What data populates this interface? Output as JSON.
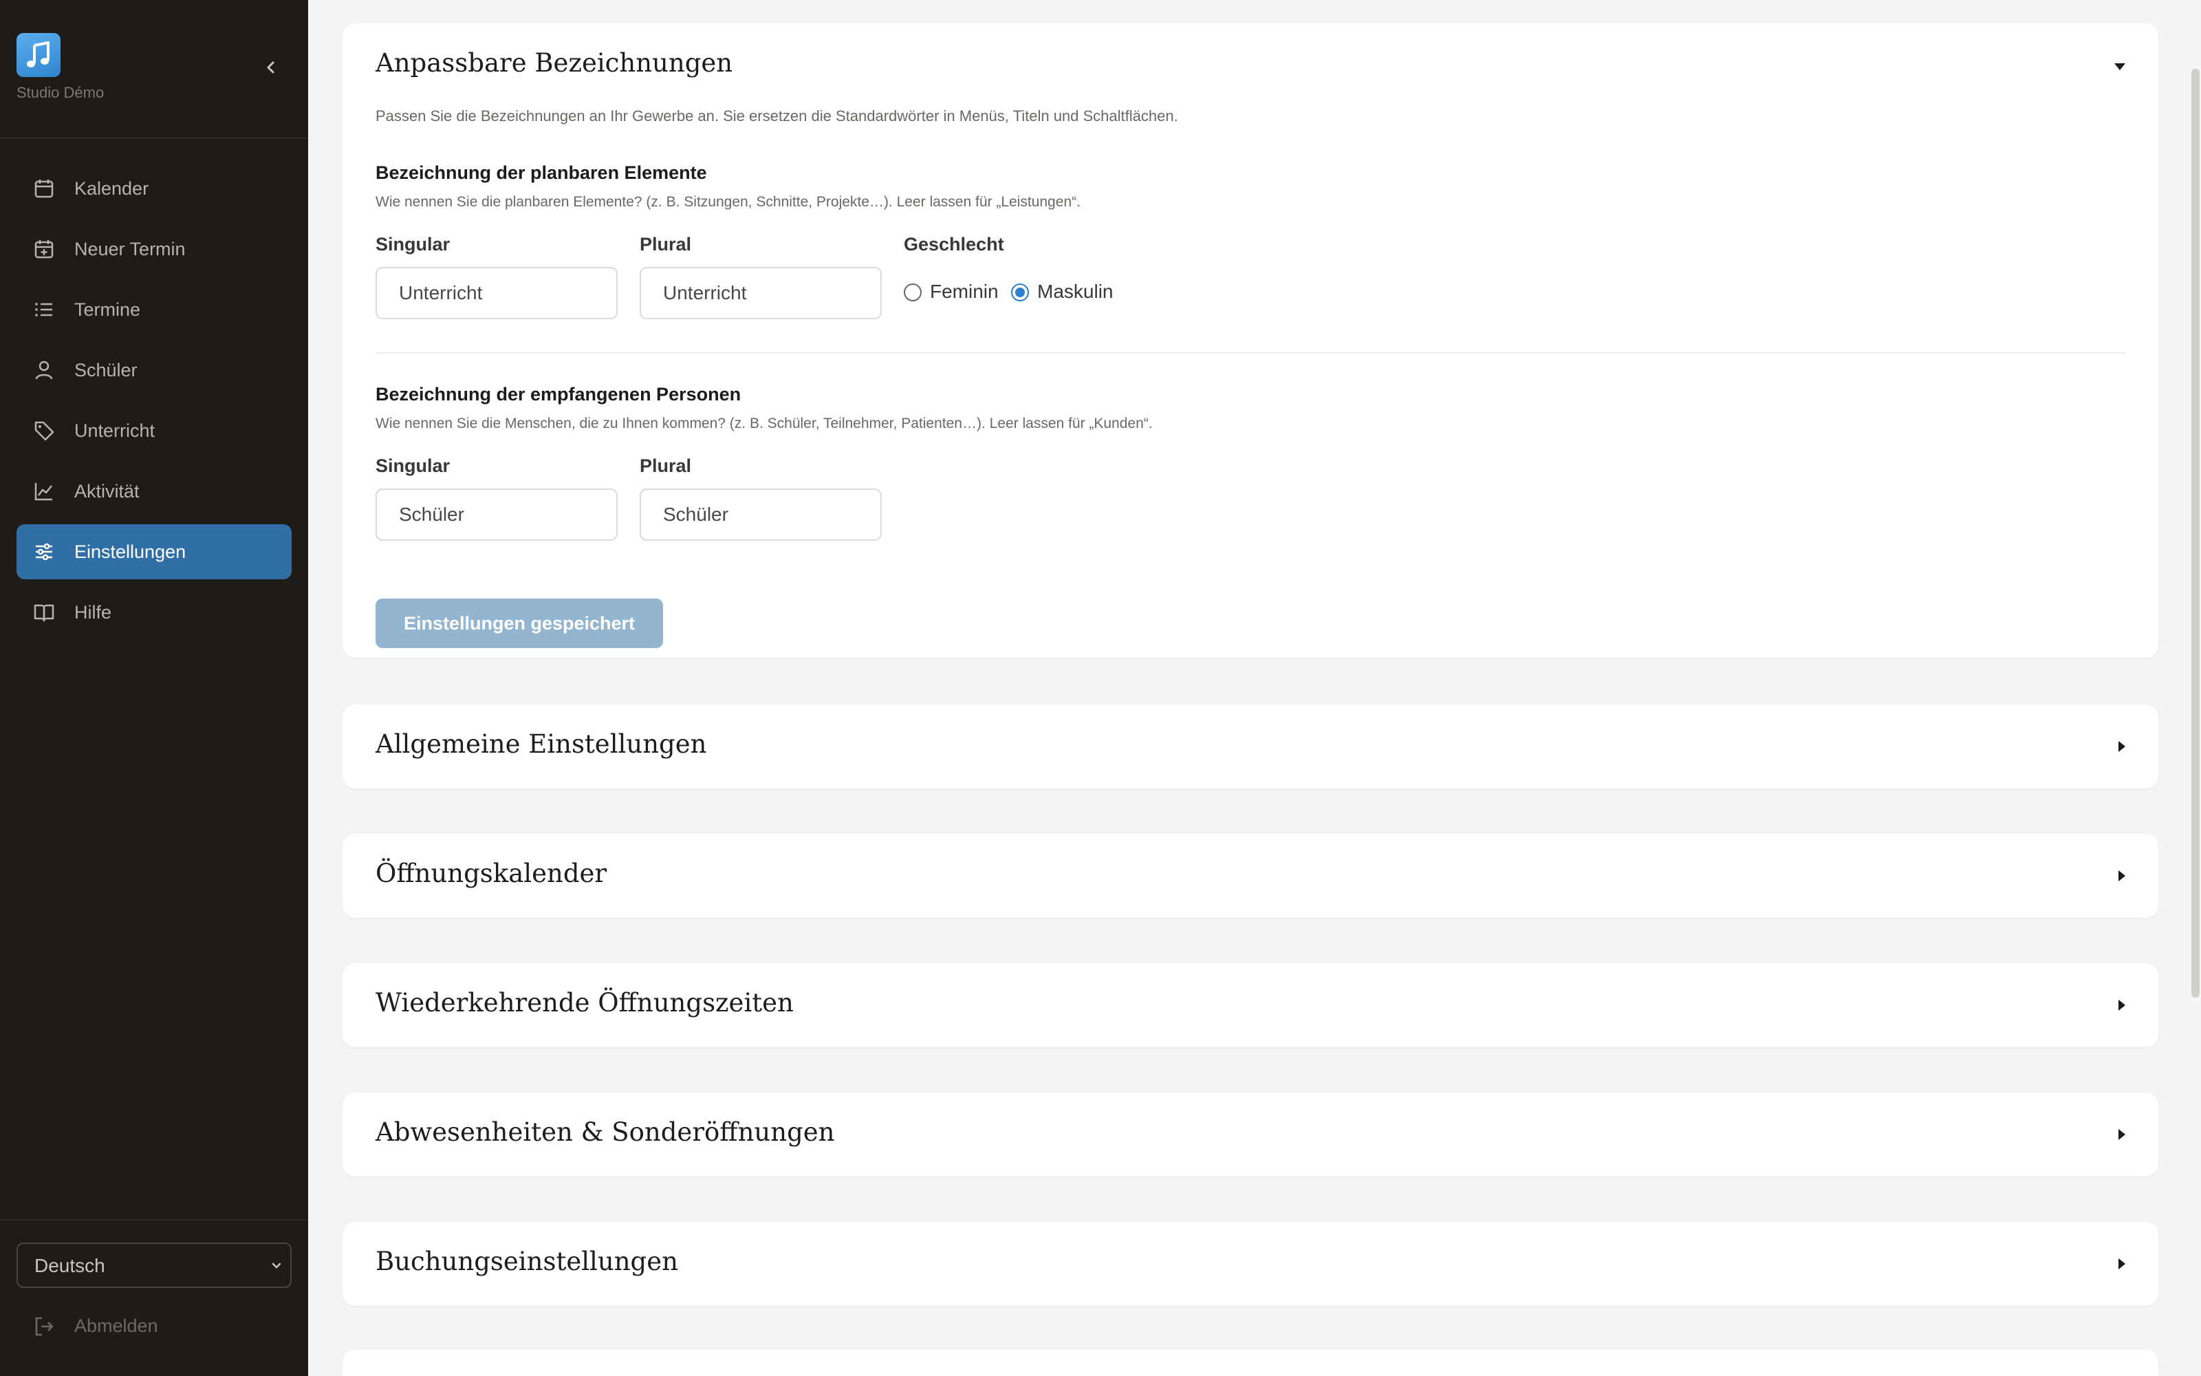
{
  "sidebar": {
    "studio_name": "Studio Démo",
    "items": [
      {
        "label": "Kalender",
        "icon": "calendar-icon"
      },
      {
        "label": "Neuer Termin",
        "icon": "calendar-plus-icon"
      },
      {
        "label": "Termine",
        "icon": "list-icon"
      },
      {
        "label": "Schüler",
        "icon": "user-icon"
      },
      {
        "label": "Unterricht",
        "icon": "tag-icon"
      },
      {
        "label": "Aktivität",
        "icon": "chart-line-icon"
      },
      {
        "label": "Einstellungen",
        "icon": "sliders-icon",
        "active": true
      },
      {
        "label": "Hilfe",
        "icon": "book-icon"
      }
    ],
    "language": "Deutsch",
    "logout": "Abmelden"
  },
  "labels_card": {
    "title": "Anpassbare Bezeichnungen",
    "intro": "Passen Sie die Bezeichnungen an Ihr Gewerbe an. Sie ersetzen die Standardwörter in Menüs, Titeln und Schaltflächen.",
    "items_section": {
      "title": "Bezeichnung der planbaren Elemente",
      "desc": "Wie nennen Sie die planbaren Elemente? (z. B. Sitzungen, Schnitte, Projekte…). Leer lassen für „Leistungen“.",
      "singular_label": "Singular",
      "singular_value": "Unterricht",
      "plural_label": "Plural",
      "plural_value": "Unterricht",
      "gender_label": "Geschlecht",
      "gender_options": [
        "Feminin",
        "Maskulin"
      ],
      "gender_selected": "Maskulin"
    },
    "persons_section": {
      "title": "Bezeichnung der empfangenen Personen",
      "desc": "Wie nennen Sie die Menschen, die zu Ihnen kommen? (z. B. Schüler, Teilnehmer, Patienten…). Leer lassen für „Kunden“.",
      "singular_label": "Singular",
      "singular_value": "Schüler",
      "plural_label": "Plural",
      "plural_value": "Schüler"
    },
    "save_button": "Einstellungen gespeichert"
  },
  "collapsed_sections": [
    {
      "title": "Allgemeine Einstellungen"
    },
    {
      "title": "Öffnungskalender"
    },
    {
      "title": "Wiederkehrende Öffnungszeiten"
    },
    {
      "title": "Abwesenheiten & Sonderöffnungen"
    },
    {
      "title": "Buchungseinstellungen"
    }
  ],
  "colors": {
    "sidebar_bg": "#1f1b18",
    "active_nav": "#2f6fa6",
    "save_button_disabled": "#93b5cf",
    "radio_accent": "#2f7fd0"
  }
}
